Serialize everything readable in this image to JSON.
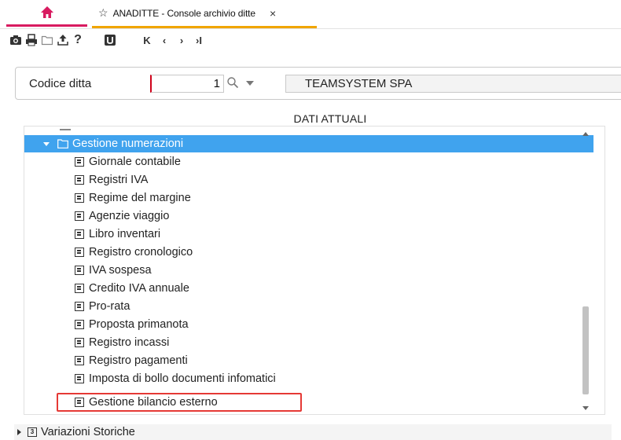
{
  "tab": {
    "title": "ANADITTE - Console archivio ditte",
    "star": "☆",
    "close": "×"
  },
  "toolbar": {
    "icons": [
      "camera-icon",
      "print-icon",
      "folder-icon",
      "upload-icon",
      "help-icon",
      "utility-icon"
    ],
    "help_label": "?",
    "nav": {
      "first": "K",
      "prev": "‹",
      "next": "›",
      "last": "›I"
    }
  },
  "codice": {
    "label": "Codice ditta",
    "value": "1",
    "company_name": "TEAMSYSTEM SPA"
  },
  "section_title": "DATI ATTUALI",
  "tree": {
    "folder_label": "Gestione numerazioni",
    "items": [
      "Giornale contabile",
      "Registri IVA",
      "Regime del margine",
      "Agenzie viaggio",
      "Libro inventari",
      "Registro cronologico",
      "IVA sospesa",
      "Credito IVA annuale",
      "Pro-rata",
      "Proposta primanota",
      "Registro incassi",
      "Registro pagamenti",
      "Imposta di bollo documenti infomatici",
      "Gestione bilancio esterno"
    ],
    "highlighted_item": "Gestione bilancio esterno"
  },
  "bottom": {
    "label": "Variazioni Storiche",
    "calendar_digit": "3"
  },
  "colors": {
    "accent_home": "#d81b60",
    "accent_tab": "#f0a500",
    "selection": "#40a3ee",
    "highlight_border": "#e53935"
  }
}
